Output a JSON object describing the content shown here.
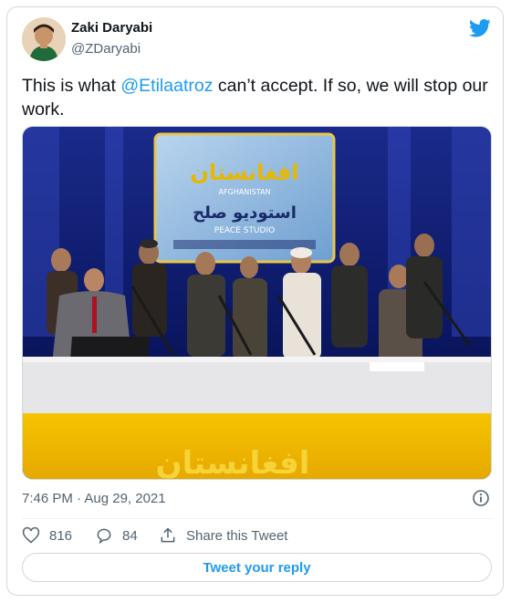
{
  "tweet": {
    "author_name": "Zaki Daryabi",
    "author_handle": "@ZDaryabi",
    "text_before": "This is what ",
    "mention": "@Etilaatroz",
    "text_after": " can’t accept. If so, we will stop our work.",
    "timestamp": "7:46 PM · Aug 29, 2021",
    "likes": "816",
    "replies": "84",
    "share_label": "Share this Tweet",
    "reply_button_label": "Tweet your reply"
  },
  "media": {
    "banner_title": "افغانستان",
    "banner_latin": "AFGHANISTAN",
    "banner_subtitle": "استودیو صلح",
    "banner_english": "PEACE STUDIO",
    "desk_text": "افغانستان"
  },
  "colors": {
    "accent": "#1d9bf0",
    "text": "#0f1419",
    "muted": "#536471",
    "border": "#cfd9de"
  },
  "icons": [
    "twitter-bird-icon",
    "info-icon",
    "heart-icon",
    "reply-bubble-icon",
    "share-icon"
  ]
}
